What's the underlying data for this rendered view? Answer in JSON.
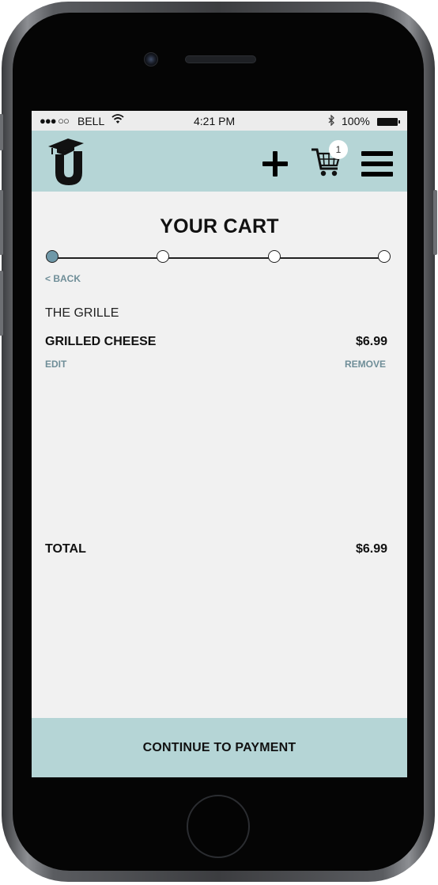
{
  "status_bar": {
    "signal": "●●● ○○",
    "carrier": "BELL",
    "wifi_icon": "wifi-icon",
    "time": "4:21 PM",
    "bluetooth_icon": "bluetooth-icon",
    "battery_percent": "100%"
  },
  "header": {
    "logo_letter": "U",
    "add_icon": "plus-icon",
    "cart_icon": "cart-icon",
    "cart_count": "1",
    "menu_icon": "hamburger-menu-icon",
    "background_color": "#b5d5d6"
  },
  "cart": {
    "title": "YOUR CART",
    "progress": {
      "steps": 4,
      "current_step": 1,
      "active_color": "#6f98a8"
    },
    "back_label": "< BACK",
    "restaurant": "THE GRILLE",
    "items": [
      {
        "name": "GRILLED CHEESE",
        "price": "$6.99",
        "edit_label": "EDIT",
        "remove_label": "REMOVE"
      }
    ],
    "total_label": "TOTAL",
    "total_value": "$6.99",
    "continue_label": "CONTINUE TO PAYMENT"
  }
}
